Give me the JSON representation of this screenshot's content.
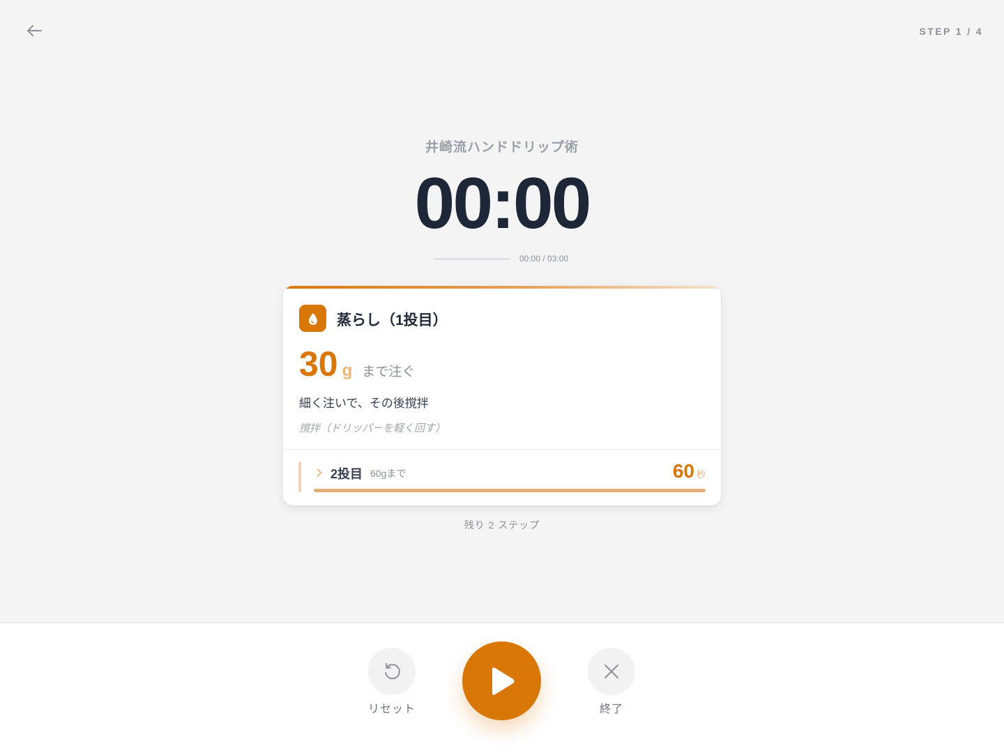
{
  "header": {
    "back_icon": "arrow-left-icon",
    "step_indicator": "STEP 1 / 4"
  },
  "recipe": {
    "name": "井崎流ハンドドリップ術"
  },
  "timer": {
    "display": "00:00",
    "elapsed_total": "00:00 / 03:00",
    "progress_fraction": 0
  },
  "current_step": {
    "icon": "water-drop-icon",
    "title": "蒸らし（1投目）",
    "amount_value": "30",
    "amount_unit": "g",
    "amount_suffix": "まで注ぐ",
    "instruction": "細く注いで、その後撹拌",
    "note": "撹拌（ドリッパーを軽く回す）"
  },
  "next_step": {
    "chevron_icon": "chevron-right-icon",
    "label": "2投目",
    "detail": "60gまで",
    "time_value": "60",
    "time_unit": "秒",
    "progress_fraction": 1
  },
  "remaining_text": "残り 2 ステップ",
  "controls": {
    "reset_label": "リセット",
    "reset_icon": "reset-icon",
    "play_icon": "play-icon",
    "end_label": "終了",
    "end_icon": "close-icon"
  },
  "colors": {
    "accent": "#d97706",
    "accent_light": "#eeb274",
    "background": "#f4f4f4",
    "timer_text": "#1e2738"
  }
}
